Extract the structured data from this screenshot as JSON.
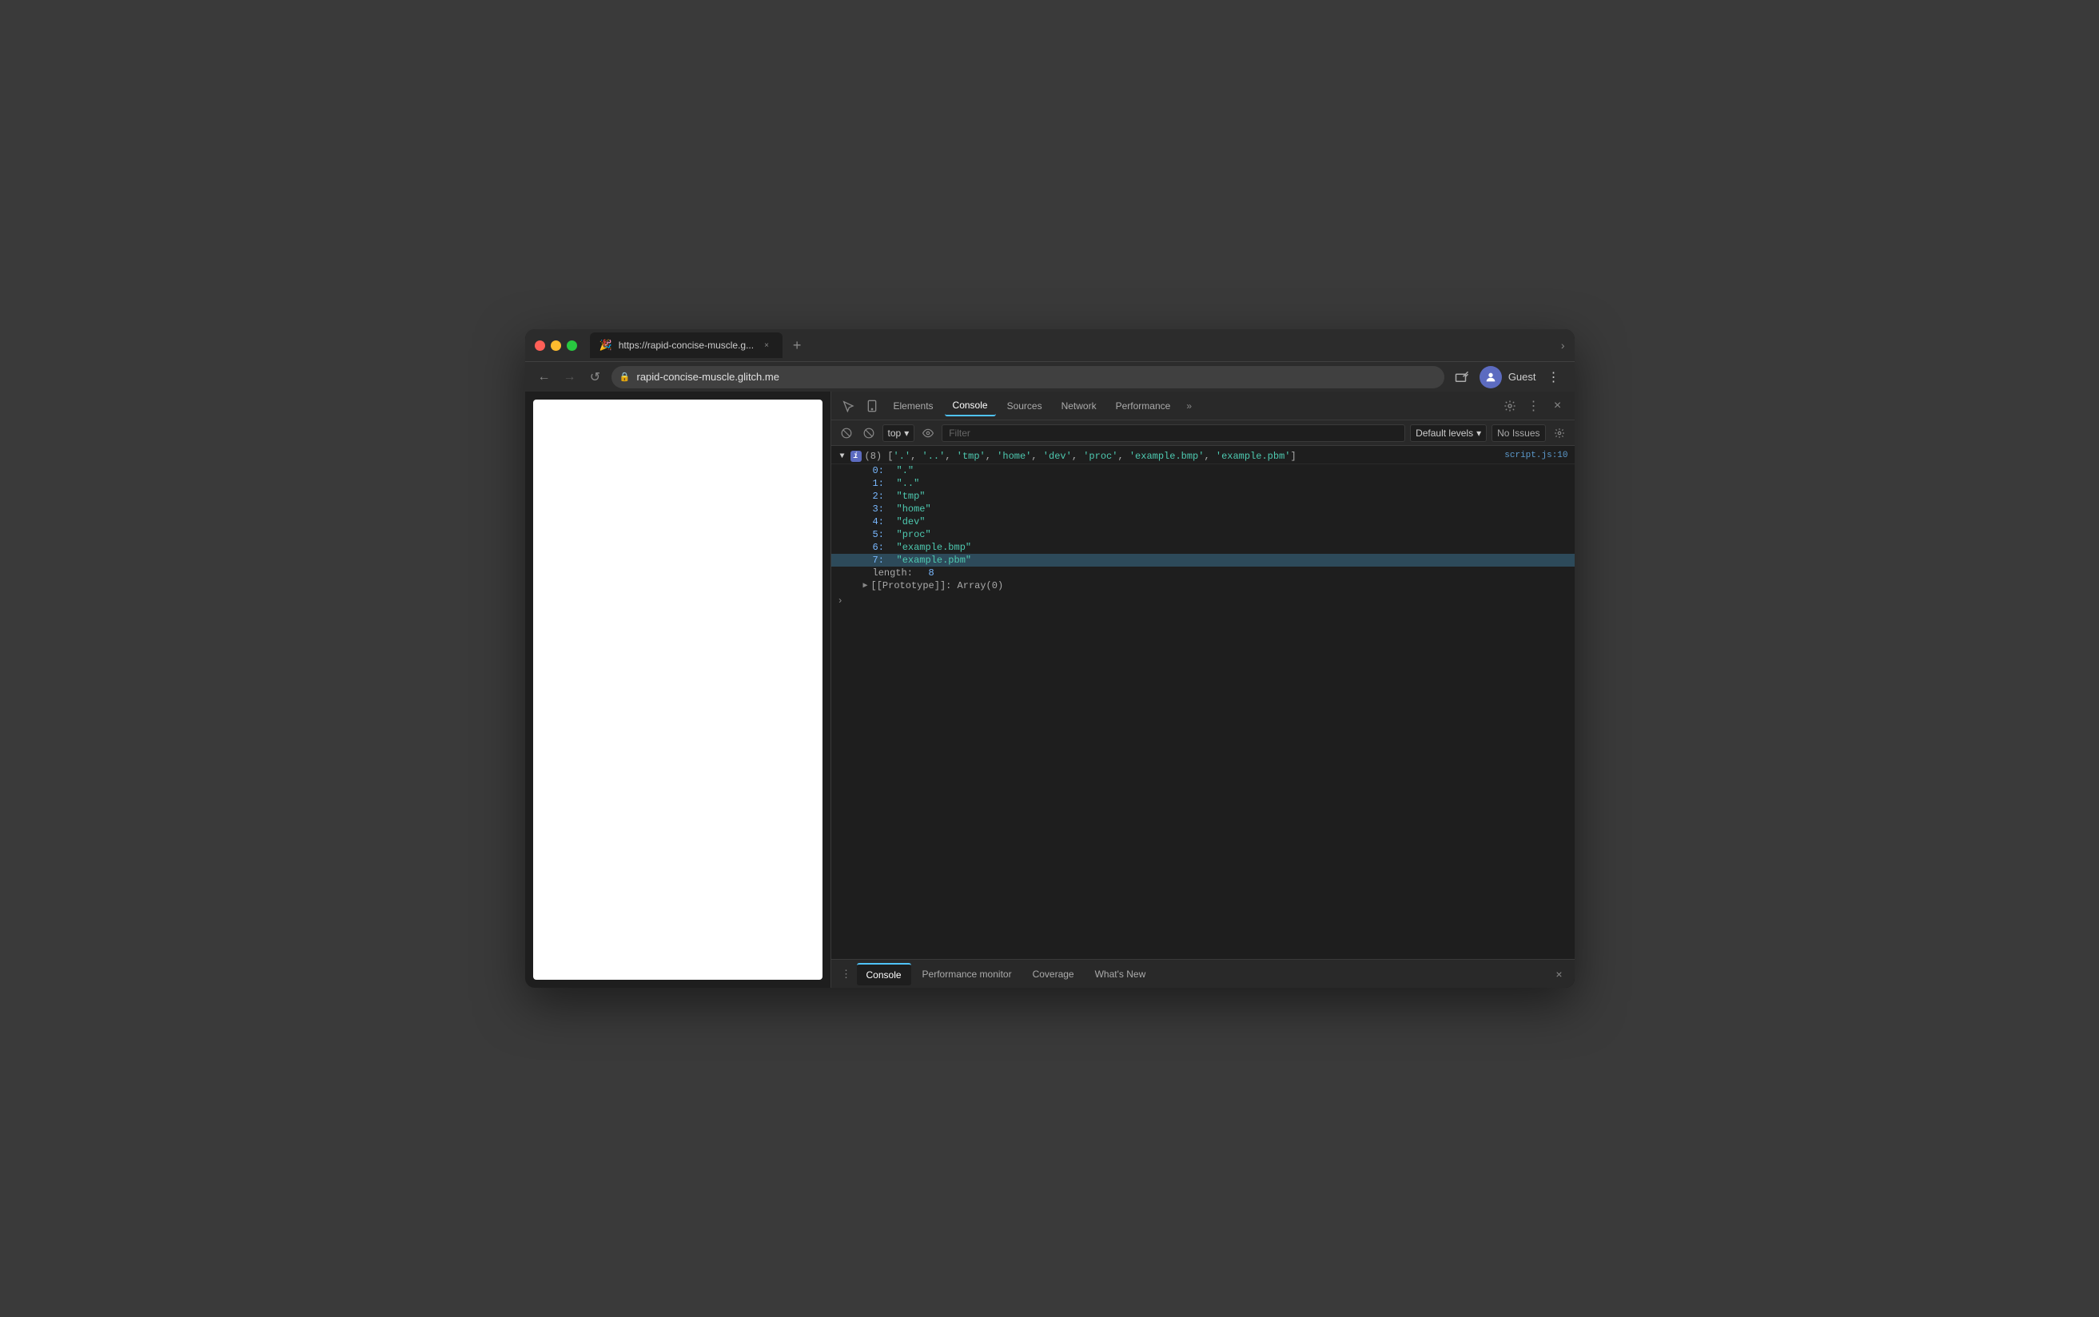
{
  "browser": {
    "tab": {
      "favicon": "🎉",
      "url_short": "https://rapid-concise-muscle.g...",
      "close_label": "×"
    },
    "new_tab_label": "+",
    "chevron": "›",
    "nav": {
      "back_label": "←",
      "forward_label": "→",
      "reload_label": "↺",
      "lock_label": "🔒",
      "url": "rapid-concise-muscle.glitch.me"
    },
    "toolbar": {
      "cast_icon": "⬜",
      "profile_icon": "👤",
      "profile_label": "Guest",
      "menu_icon": "⋮"
    }
  },
  "devtools": {
    "tabs": {
      "inspect_icon": "⬚",
      "device_icon": "📱",
      "elements": "Elements",
      "console": "Console",
      "sources": "Sources",
      "network": "Network",
      "performance": "Performance",
      "more": "»",
      "settings_icon": "⚙",
      "more_icon": "⋮",
      "close_icon": "×"
    },
    "console_toolbar": {
      "clear_icon": "🚫",
      "no_clear_icon": "⊘",
      "context": "top",
      "context_arrow": "▾",
      "eye_icon": "👁",
      "filter_placeholder": "Filter",
      "default_levels": "Default levels",
      "default_levels_arrow": "▾",
      "no_issues": "No Issues",
      "settings_icon": "⚙"
    },
    "console_output": {
      "source_link": "script.js:10",
      "array_count": "(8)",
      "array_preview": "['.', '..', 'tmp', 'home', 'dev', 'proc', 'example.bmp', 'example.pbm']",
      "items": [
        {
          "index": "0:",
          "value": "\".\""
        },
        {
          "index": "1:",
          "value": "\"..\""
        },
        {
          "index": "2:",
          "value": "\"tmp\""
        },
        {
          "index": "3:",
          "value": "\"home\""
        },
        {
          "index": "4:",
          "value": "\"dev\""
        },
        {
          "index": "5:",
          "value": "\"proc\""
        },
        {
          "index": "6:",
          "value": "\"example.bmp\""
        },
        {
          "index": "7:",
          "value": "\"example.pbm\"",
          "highlighted": true
        }
      ],
      "length_key": "length:",
      "length_val": "8",
      "prototype": "[[Prototype]]: Array(0)"
    },
    "bottom_bar": {
      "menu_icon": "⋮",
      "tabs": [
        {
          "label": "Console",
          "active": true
        },
        {
          "label": "Performance monitor",
          "active": false
        },
        {
          "label": "Coverage",
          "active": false
        },
        {
          "label": "What's New",
          "active": false
        }
      ],
      "close_icon": "×"
    }
  }
}
